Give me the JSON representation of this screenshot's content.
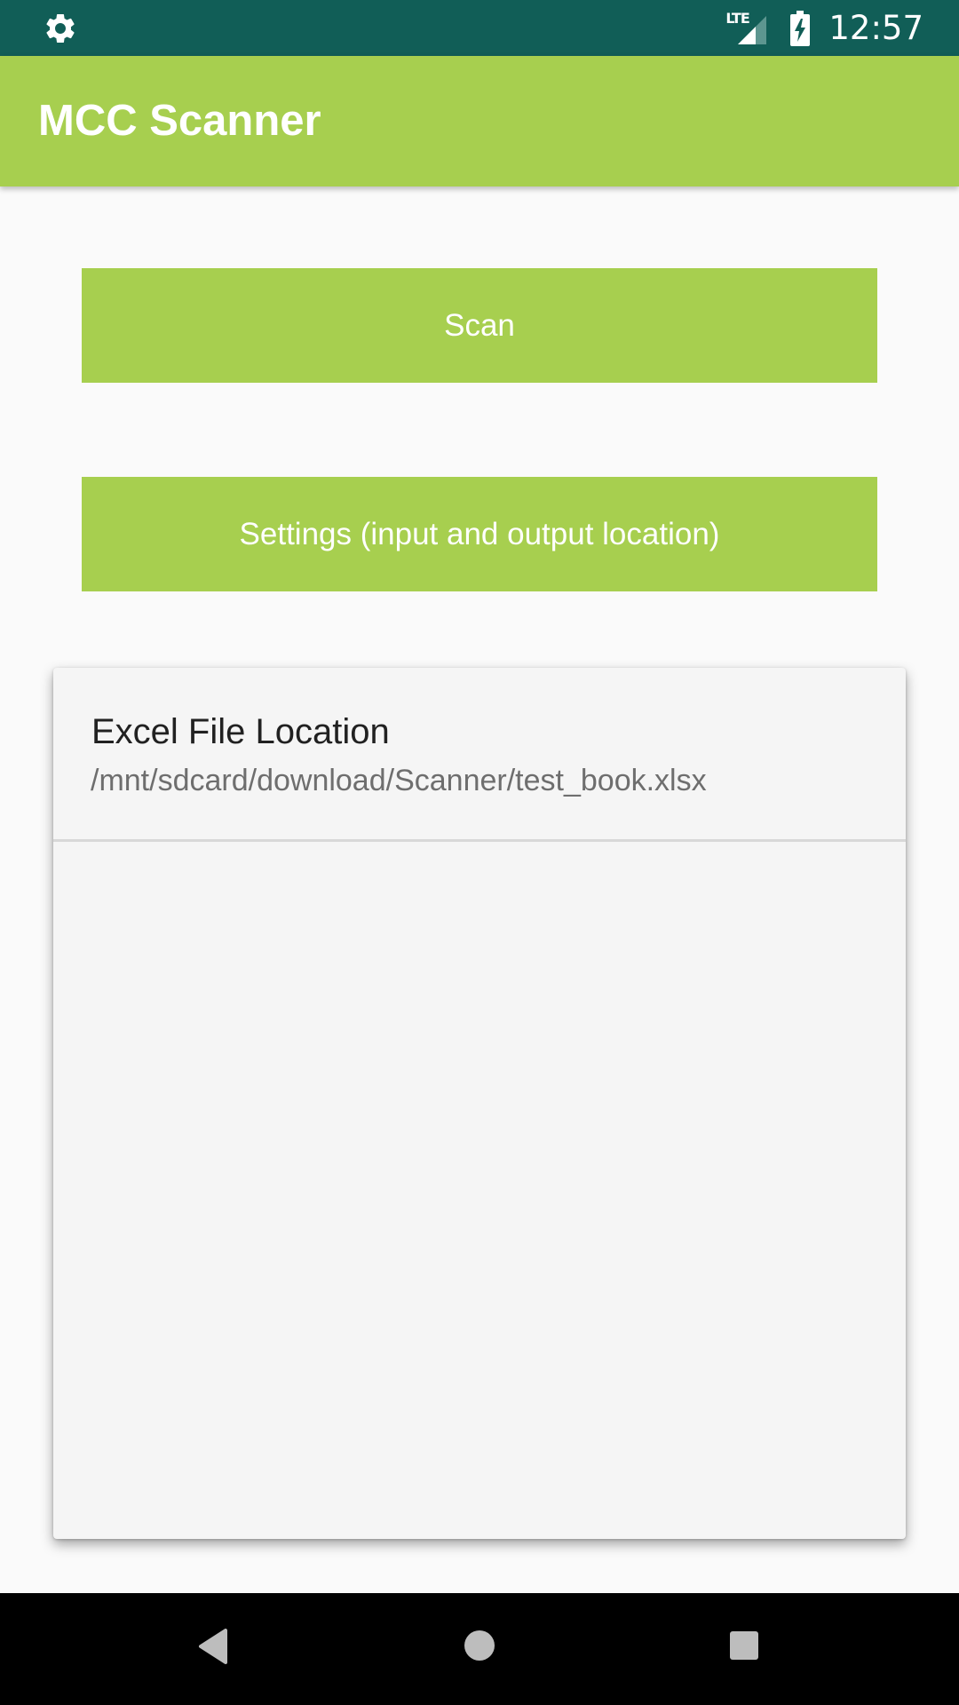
{
  "status_bar": {
    "time": "12:57",
    "network_label": "LTE",
    "icons": [
      "gear-icon",
      "lte-signal-icon",
      "battery-charging-icon"
    ]
  },
  "app_bar": {
    "title": "MCC Scanner"
  },
  "buttons": {
    "scan_label": "Scan",
    "settings_label": "Settings (input and output location)"
  },
  "card": {
    "rows": [
      {
        "title": "Excel File Location",
        "subtitle": "/mnt/sdcard/download/Scanner/test_book.xlsx"
      }
    ]
  },
  "nav_bar": {
    "icons": [
      "back-icon",
      "home-icon",
      "recents-icon"
    ]
  },
  "colors": {
    "status_bar": "#115e57",
    "accent": "#a7cf4f",
    "background": "#fafafa",
    "card": "#f5f5f5"
  }
}
